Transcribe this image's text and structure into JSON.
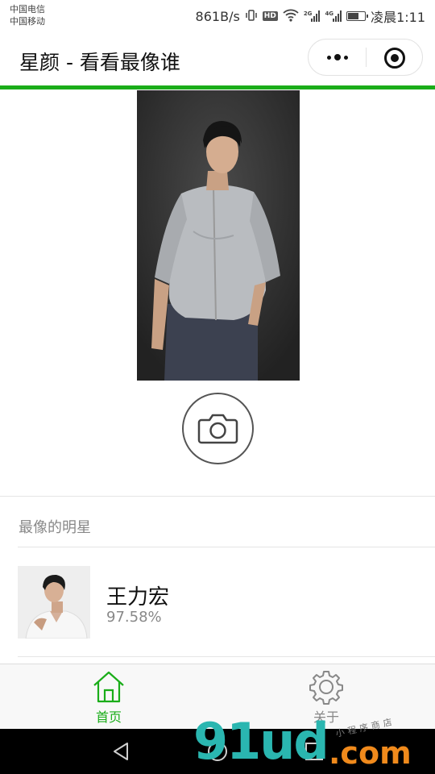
{
  "status_bar": {
    "carrier_1": "中国电信",
    "carrier_2": "中国移动",
    "net_speed": "861B/s",
    "hd_label": "HD",
    "net_tag_1": "2G",
    "net_tag_2": "4G",
    "time": "凌晨1:11",
    "battery_level": 0.7
  },
  "title_bar": {
    "title": "星颜 - 看看最像谁",
    "menu_icon": "more-dots-icon",
    "close_icon": "mini-program-close-icon",
    "accent_color": "#1aad19"
  },
  "main": {
    "photo_icon": "uploaded-photo",
    "camera_icon": "camera-icon"
  },
  "results": {
    "header": "最像的明星",
    "items": [
      {
        "name": "王力宏",
        "score": "97.58%"
      }
    ]
  },
  "tab_bar": {
    "tabs": [
      {
        "label": "首页",
        "icon": "home-icon",
        "active": true,
        "color": "#1aad19"
      },
      {
        "label": "关于",
        "icon": "gear-icon",
        "active": false,
        "color": "#888888"
      }
    ]
  },
  "nav_bar": {
    "icons": [
      "back-icon",
      "home-circle-icon",
      "recents-icon"
    ]
  },
  "watermark": {
    "main": "91ud",
    "suffix": ".com",
    "small": "小程序商店"
  }
}
